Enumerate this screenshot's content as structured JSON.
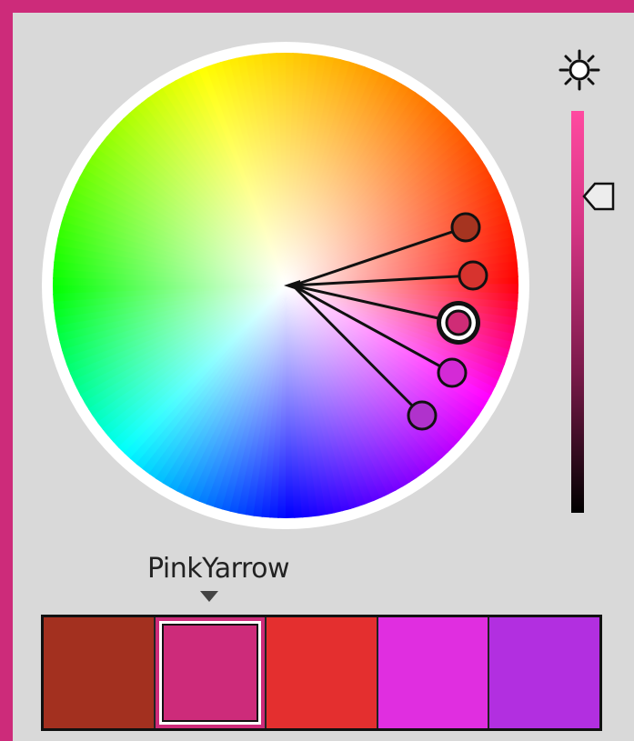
{
  "window": {
    "frame_color": "#cd2b7a",
    "background": "#d9d9d9"
  },
  "wheel": {
    "center_marker": "wheel-center-pointer",
    "handles": [
      {
        "name": "handle-1",
        "color": "#a63420",
        "selected": false
      },
      {
        "name": "handle-2",
        "color": "#d7332e",
        "selected": false
      },
      {
        "name": "handle-3",
        "color": "#cf2c76",
        "selected": true
      },
      {
        "name": "handle-4",
        "color": "#d42ad6",
        "selected": false
      },
      {
        "name": "handle-5",
        "color": "#b032cc",
        "selected": false
      }
    ]
  },
  "brightness": {
    "icon": "sun-icon",
    "slider_top_color": "#ff4aa0",
    "slider_bottom_color": "#000000"
  },
  "scheme": {
    "name": "PinkYarrow",
    "caret_icon": "caret-down-icon"
  },
  "swatches": [
    {
      "color": "#a3301f",
      "selected": false
    },
    {
      "color": "#cd2b7a",
      "selected": true
    },
    {
      "color": "#e42f2f",
      "selected": false
    },
    {
      "color": "#e02ee0",
      "selected": false
    },
    {
      "color": "#b22fe0",
      "selected": false
    }
  ]
}
